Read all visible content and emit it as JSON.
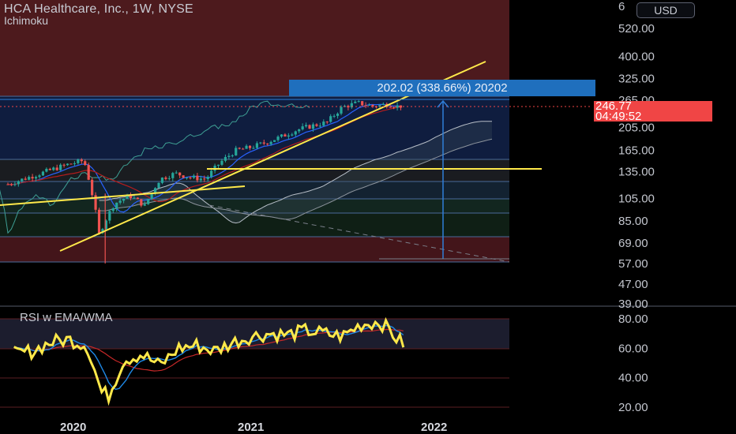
{
  "header": {
    "title": "HCA Healthcare, Inc., 1W, NYSE",
    "indicator": "Ichimoku",
    "currency_button": "USD"
  },
  "measure_label": "202.02 (338.66%) 20202",
  "price_tag": {
    "price": "246.77",
    "countdown": "04:49:52",
    "color": "#f04545"
  },
  "rsi": {
    "label": "RSI w EMA/WMA"
  },
  "colors": {
    "up": "#26a69a",
    "down": "#ef5350",
    "trendline": "#ffe94a",
    "cloud": "#9aa3ad",
    "measure": "#2f7ed8"
  },
  "chart_data": [
    {
      "type": "candlestick",
      "title": "HCA Healthcare, Inc., 1W, NYSE",
      "y_scale": "log",
      "y_ticks": [
        "520.00",
        "400.00",
        "325.00",
        "265.00",
        "205.00",
        "165.00",
        "135.00",
        "105.00",
        "85.00",
        "69.00",
        "57.00",
        "47.00",
        "39.00"
      ],
      "top_tick_partial": "6",
      "x_ticks": [
        "2020",
        "2021",
        "2022"
      ],
      "close_points": [
        [
          "2019-09",
          120
        ],
        [
          "2019-11",
          132
        ],
        [
          "2020-01",
          145
        ],
        [
          "2020-02",
          150
        ],
        [
          "2020-03",
          75
        ],
        [
          "2020-04",
          100
        ],
        [
          "2020-05",
          108
        ],
        [
          "2020-06",
          98
        ],
        [
          "2020-07",
          126
        ],
        [
          "2020-08",
          133
        ],
        [
          "2020-09",
          128
        ],
        [
          "2020-10",
          126
        ],
        [
          "2020-11",
          148
        ],
        [
          "2020-12",
          165
        ],
        [
          "2021-01",
          170
        ],
        [
          "2021-02",
          178
        ],
        [
          "2021-03",
          188
        ],
        [
          "2021-04",
          200
        ],
        [
          "2021-05",
          208
        ],
        [
          "2021-06",
          215
        ],
        [
          "2021-07",
          248
        ],
        [
          "2021-08",
          258
        ],
        [
          "2021-09",
          250
        ],
        [
          "2021-10",
          255
        ],
        [
          "2021-11",
          246.77
        ]
      ],
      "current_price": 246.77
    },
    {
      "type": "line",
      "title": "RSI w EMA/WMA",
      "y_ticks": [
        "80.00",
        "60.00",
        "40.00",
        "20.00"
      ],
      "ylim": [
        20,
        80
      ],
      "series": [
        {
          "values": [
            [
              2019.7,
              56
            ],
            [
              2019.8,
              58
            ],
            [
              2019.9,
              64
            ],
            [
              2020.0,
              66
            ],
            [
              2020.1,
              62
            ],
            [
              2020.18,
              30
            ],
            [
              2020.22,
              28
            ],
            [
              2020.3,
              52
            ],
            [
              2020.4,
              56
            ],
            [
              2020.5,
              48
            ],
            [
              2020.6,
              60
            ],
            [
              2020.7,
              62
            ],
            [
              2020.8,
              58
            ],
            [
              2020.9,
              64
            ],
            [
              2021.0,
              68
            ],
            [
              2021.1,
              70
            ],
            [
              2021.2,
              69
            ],
            [
              2021.3,
              72
            ],
            [
              2021.4,
              70
            ],
            [
              2021.5,
              68
            ],
            [
              2021.6,
              76
            ],
            [
              2021.7,
              78
            ],
            [
              2021.75,
              74
            ],
            [
              2021.8,
              66
            ],
            [
              2021.85,
              62
            ]
          ]
        }
      ]
    }
  ]
}
